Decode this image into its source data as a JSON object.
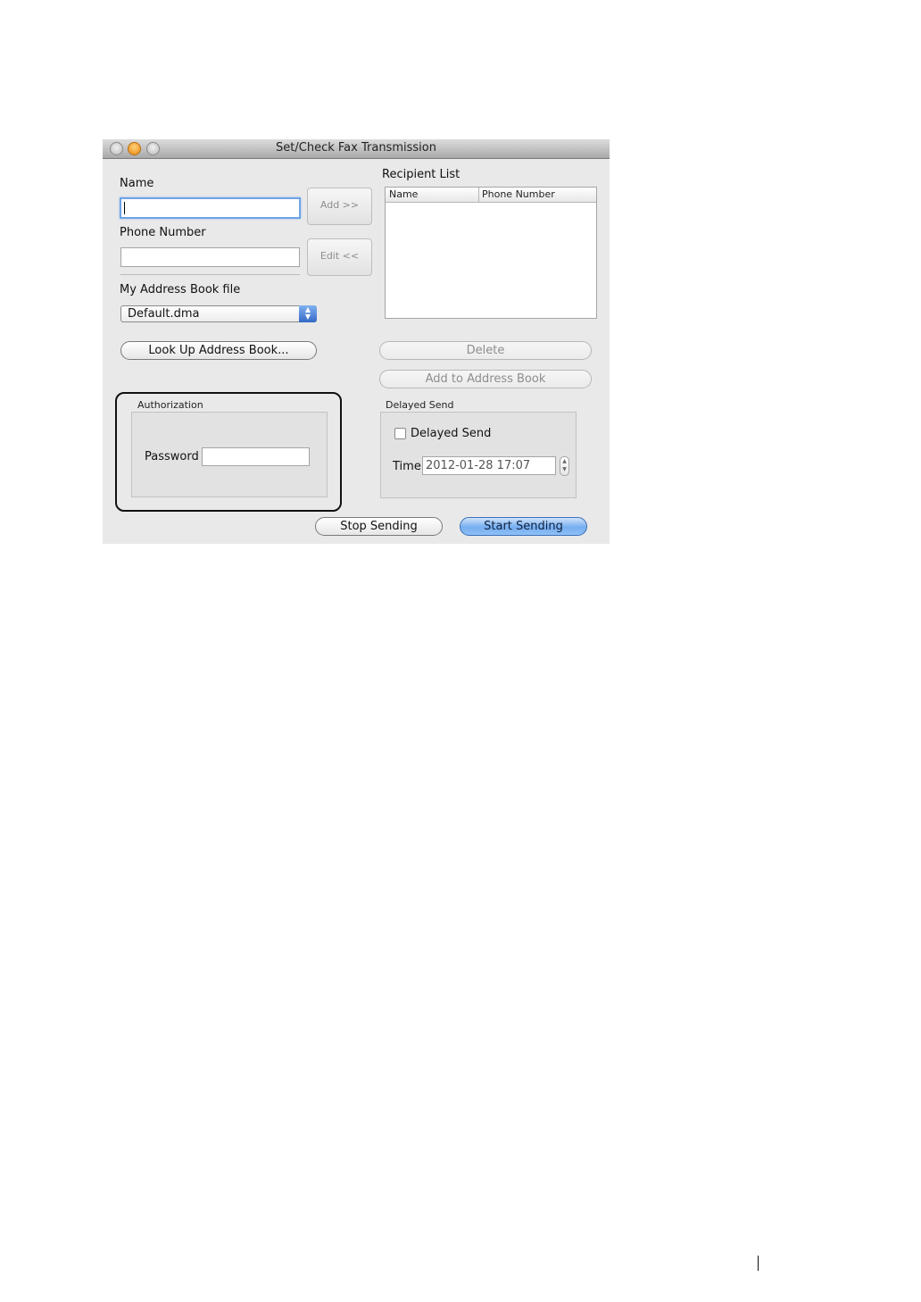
{
  "window": {
    "title": "Set/Check Fax Transmission"
  },
  "form": {
    "name_label": "Name",
    "name_value": "",
    "phone_label": "Phone Number",
    "phone_value": "",
    "add_button": "Add >>",
    "edit_button": "Edit <<",
    "address_book_file_label": "My Address Book file",
    "address_book_file_selected": "Default.dma",
    "lookup_button": "Look Up Address Book..."
  },
  "recipients": {
    "title": "Recipient List",
    "columns": [
      "Name",
      "Phone Number"
    ],
    "rows": [],
    "delete_button": "Delete",
    "add_to_book_button": "Add to Address Book"
  },
  "authorization": {
    "title": "Authorization",
    "password_label": "Password",
    "password_value": ""
  },
  "delayed_send": {
    "title": "Delayed Send",
    "checkbox_label": "Delayed Send",
    "checked": false,
    "time_label": "Time",
    "time_value": "2012-01-28 17:07"
  },
  "actions": {
    "stop_button": "Stop Sending",
    "start_button": "Start Sending"
  }
}
